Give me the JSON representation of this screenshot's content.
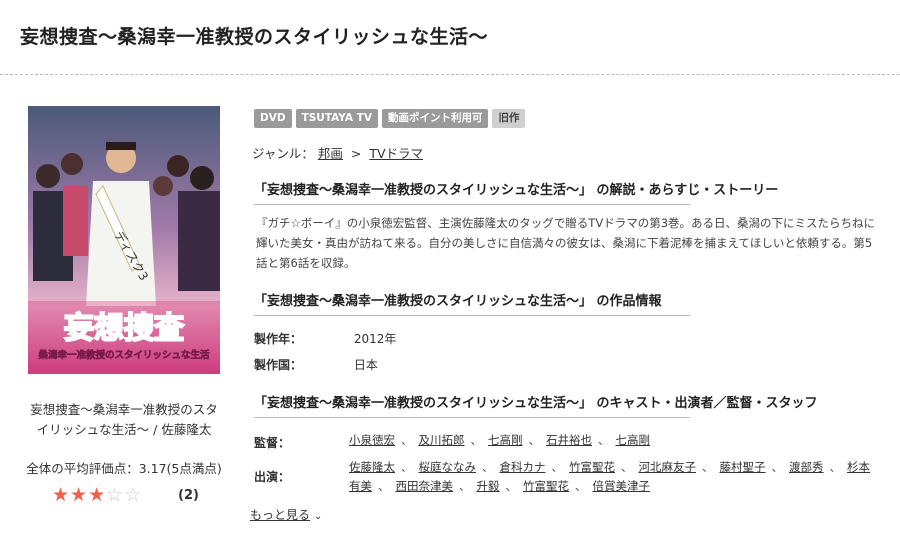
{
  "page": {
    "title": "妄想捜査～桑潟幸一准教授のスタイリッシュな生活～"
  },
  "cover": {
    "alt_title": "妄想捜査",
    "subtitle": "桑潟幸一准教授のスタイリッシュな生活",
    "sash_text": "ディスク3"
  },
  "left": {
    "caption": "妄想捜査～桑潟幸一准教授のスタイリッシュな生活～ / 佐藤隆太",
    "rating_text": "全体の平均評価点：3.17(5点満点)",
    "rating_value": 3,
    "rating_max": 5,
    "review_count": "(2)"
  },
  "badges": [
    "DVD",
    "TSUTAYA TV",
    "動画ポイント利用可",
    "旧作"
  ],
  "genre": {
    "label": "ジャンル：",
    "items": [
      "邦画",
      "TVドラマ"
    ],
    "separator": ">"
  },
  "sections": {
    "synopsis_heading": "「妄想捜査～桑潟幸一准教授のスタイリッシュな生活～」 の解説・あらすじ・ストーリー",
    "synopsis": "『ガチ☆ボーイ』の小泉徳宏監督、主演佐藤隆太のタッグで贈るTVドラマの第3巻。ある日、桑潟の下にミスたらちねに輝いた美女・真由が訪ねて来る。自分の美しさに自信満々の彼女は、桑潟に下着泥棒を捕まえてほしいと依頼する。第5話と第6話を収録。",
    "info_heading": "「妄想捜査～桑潟幸一准教授のスタイリッシュな生活～」 の作品情報",
    "info": [
      {
        "label": "製作年：",
        "value": "2012年"
      },
      {
        "label": "製作国：",
        "value": "日本"
      }
    ],
    "cast_heading": "「妄想捜査～桑潟幸一准教授のスタイリッシュな生活～」 のキャスト・出演者／監督・スタッフ",
    "director_label": "監督：",
    "directors": [
      "小泉徳宏",
      "及川拓郎",
      "七高剛",
      "石井裕也",
      "七高剛"
    ],
    "cast_label": "出演：",
    "cast": [
      "佐藤隆太",
      "桜庭ななみ",
      "倉科カナ",
      "竹富聖花",
      "河北麻友子",
      "藤村聖子",
      "渡部秀",
      "杉本有美",
      "西田奈津美",
      "升毅",
      "竹富聖花",
      "倍賞美津子"
    ],
    "list_separator": "、"
  },
  "more_link": "もっと見る",
  "colors": {
    "star_on": "#f0604a",
    "star_off": "#cccccc",
    "badge_bg": "#9a9a9a"
  }
}
